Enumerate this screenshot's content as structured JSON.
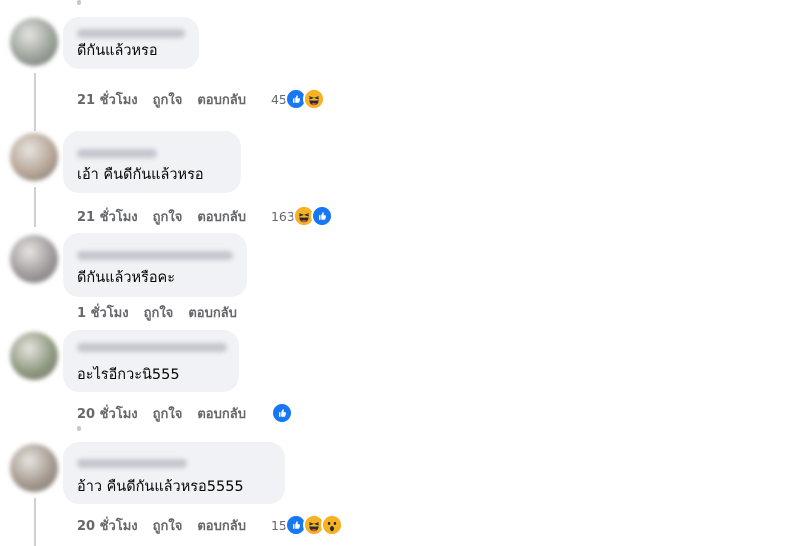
{
  "comments": [
    {
      "text": "ดีกันแล้วหรอ",
      "time": "21 ชั่วโมง",
      "like_label": "ถูกใจ",
      "reply_label": "ตอบกลับ",
      "reaction_count": "45",
      "reactions": [
        "like-icon",
        "haha-icon"
      ],
      "avatar_color": "#9aa39a"
    },
    {
      "text": "เอ้า คืนดีกันแล้วหรอ",
      "time": "21 ชั่วโมง",
      "like_label": "ถูกใจ",
      "reply_label": "ตอบกลับ",
      "reaction_count": "163",
      "reactions": [
        "haha-icon",
        "like-icon"
      ],
      "avatar_color": "#b7a697"
    },
    {
      "text": "ดีกันแล้วหรือคะ",
      "time": "1 ชั่วโมง",
      "like_label": "ถูกใจ",
      "reply_label": "ตอบกลับ",
      "reaction_count": "",
      "reactions": [],
      "avatar_color": "#a09a9c"
    },
    {
      "text": "อะไรอีกวะนิ555",
      "time": "20 ชั่วโมง",
      "like_label": "ถูกใจ",
      "reply_label": "ตอบกลับ",
      "reaction_count": "",
      "reactions": [
        "like-icon"
      ],
      "avatar_color": "#8f9a80"
    },
    {
      "text": "อ้าว คืนดีกันแล้วหรอ5555",
      "time": "20 ชั่วโมง",
      "like_label": "ถูกใจ",
      "reply_label": "ตอบกลับ",
      "reaction_count": "15",
      "reactions": [
        "like-icon",
        "haha-icon",
        "wow-icon"
      ],
      "avatar_color": "#a69a90"
    }
  ],
  "colors": {
    "like": "#1877f2",
    "haha": "#f7b125",
    "bubble": "#f0f2f5",
    "meta_text": "#65676b"
  }
}
